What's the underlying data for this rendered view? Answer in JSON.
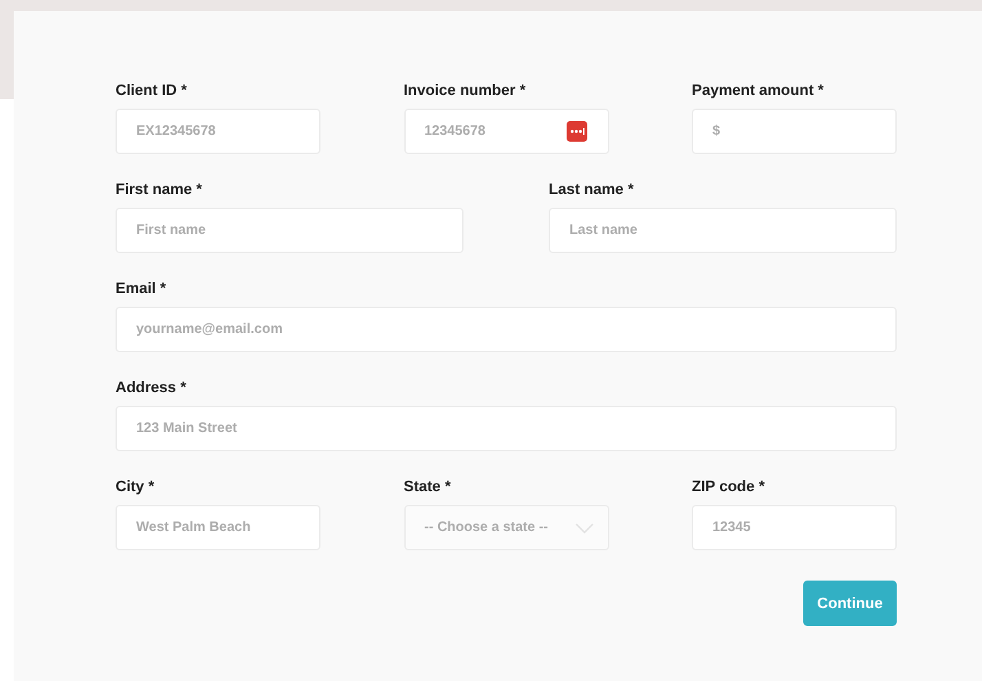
{
  "form": {
    "rows": [
      {
        "fields": [
          {
            "kind": "text",
            "label": "Client ID *",
            "placeholder": "EX12345678"
          },
          {
            "kind": "autofill",
            "label": "Invoice number *",
            "placeholder": "12345678"
          },
          {
            "kind": "text",
            "label": "Payment amount *",
            "placeholder": "$"
          }
        ]
      },
      {
        "fields": [
          {
            "kind": "text",
            "label": "First name *",
            "placeholder": "First name"
          },
          {
            "kind": "text",
            "label": "Last name *",
            "placeholder": "Last name"
          }
        ]
      },
      {
        "fields": [
          {
            "kind": "text",
            "label": "Email *",
            "placeholder": "yourname@email.com"
          }
        ]
      },
      {
        "fields": [
          {
            "kind": "text",
            "label": "Address *",
            "placeholder": "123 Main Street"
          }
        ]
      },
      {
        "fields": [
          {
            "kind": "text",
            "label": "City *",
            "placeholder": "West Palm Beach"
          },
          {
            "kind": "select",
            "label": "State *",
            "placeholder": "-- Choose a state --"
          },
          {
            "kind": "text",
            "label": "ZIP code *",
            "placeholder": "12345"
          }
        ]
      }
    ],
    "submit": "Continue"
  }
}
